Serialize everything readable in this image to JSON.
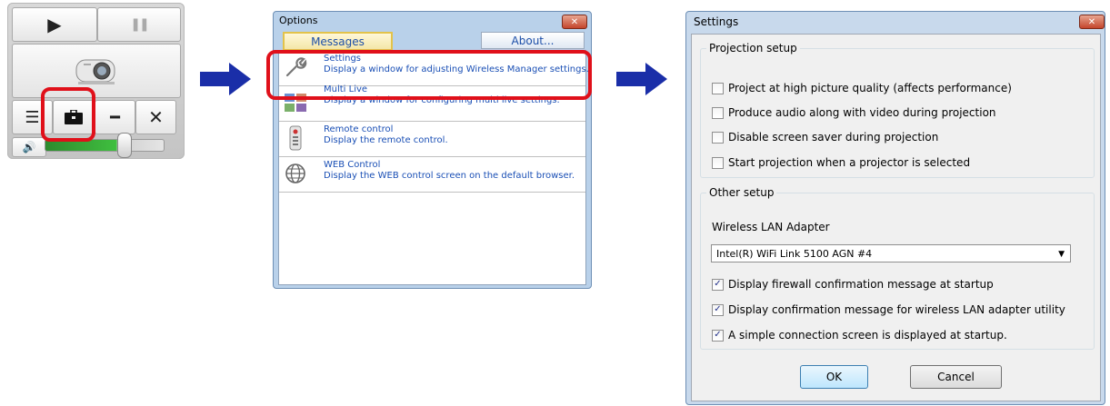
{
  "controls": {
    "play_icon": "play-icon",
    "pause_icon": "pause-icon",
    "list_icon": "list-icon",
    "toolbox_icon": "toolbox-icon",
    "minimize_icon": "minimize-icon",
    "close_icon": "close-icon",
    "volume_icon": "speaker-icon",
    "volume_level": 0.62
  },
  "options": {
    "title": "Options",
    "tab_messages": "Messages",
    "tab_about": "About...",
    "items": [
      {
        "icon": "wrench-icon",
        "title": "Settings",
        "desc": "Display a window for adjusting Wireless Manager settings."
      },
      {
        "icon": "multi-live-icon",
        "title": "Multi Live",
        "desc": "Display a window for configuring multi live settings."
      },
      {
        "icon": "remote-control-icon",
        "title": "Remote control",
        "desc": "Display the remote control."
      },
      {
        "icon": "globe-icon",
        "title": "WEB Control",
        "desc": "Display the WEB control screen on the default browser."
      }
    ]
  },
  "settings": {
    "title": "Settings",
    "projection_group": "Projection setup",
    "projection_options": [
      {
        "label": "Project at high picture quality (affects performance)",
        "checked": false
      },
      {
        "label": "Produce audio along with video during projection",
        "checked": false
      },
      {
        "label": "Disable screen saver during projection",
        "checked": false
      },
      {
        "label": "Start projection when a projector is selected",
        "checked": false
      }
    ],
    "other_group": "Other setup",
    "adapter_label": "Wireless LAN Adapter",
    "adapter_value": "Intel(R) WiFi Link 5100 AGN #4",
    "other_options": [
      {
        "label": "Display firewall confirmation message at startup",
        "checked": true
      },
      {
        "label": "Display confirmation message for wireless LAN adapter utility",
        "checked": true
      },
      {
        "label": "A simple connection screen is displayed at startup.",
        "checked": true
      }
    ],
    "ok_label": "OK",
    "cancel_label": "Cancel"
  },
  "colors": {
    "arrow": "#1a2ea8",
    "highlight": "#e0101a",
    "link_text": "#1a4fb5"
  }
}
